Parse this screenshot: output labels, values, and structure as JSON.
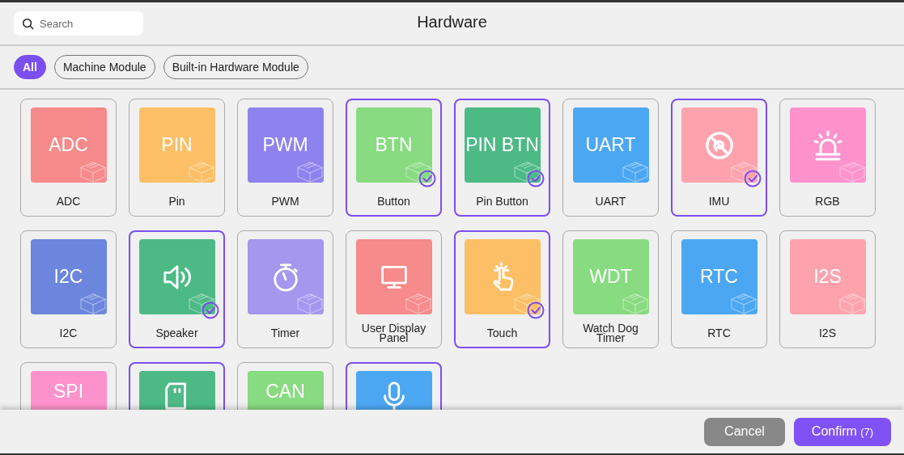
{
  "search": {
    "placeholder": "Search"
  },
  "title": "Hardware",
  "filters": [
    {
      "label": "All",
      "selected": true
    },
    {
      "label": "Machine Module",
      "selected": false
    },
    {
      "label": "Built-in Hardware Module",
      "selected": false
    }
  ],
  "modules": [
    {
      "label": "ADC",
      "kind": "text",
      "tile_text": "ADC",
      "color": "#f78a8a",
      "selected": false
    },
    {
      "label": "Pin",
      "kind": "text",
      "tile_text": "PIN",
      "color": "#fdbf66",
      "selected": false
    },
    {
      "label": "PWM",
      "kind": "text",
      "tile_text": "PWM",
      "color": "#8e82ee",
      "selected": false
    },
    {
      "label": "Button",
      "kind": "text",
      "tile_text": "BTN",
      "color": "#88db80",
      "selected": true
    },
    {
      "label": "Pin Button",
      "kind": "text",
      "tile_text": "PIN BTN",
      "color": "#4dba85",
      "selected": true
    },
    {
      "label": "UART",
      "kind": "text",
      "tile_text": "UART",
      "color": "#4ca7f2",
      "selected": false
    },
    {
      "label": "IMU",
      "kind": "imu",
      "color": "#fea3ae",
      "selected": true
    },
    {
      "label": "RGB",
      "kind": "rgb",
      "color": "#fe92cc",
      "selected": false
    },
    {
      "label": "I2C",
      "kind": "text",
      "tile_text": "I2C",
      "color": "#6b86dc",
      "selected": false
    },
    {
      "label": "Speaker",
      "kind": "speaker",
      "color": "#4dba85",
      "selected": true
    },
    {
      "label": "Timer",
      "kind": "timer",
      "color": "#a596ee",
      "selected": false
    },
    {
      "label": "User Display Panel",
      "kind": "display",
      "color": "#f78a8a",
      "selected": false
    },
    {
      "label": "Touch",
      "kind": "touch",
      "color": "#fdbf66",
      "selected": true
    },
    {
      "label": "Watch Dog Timer",
      "kind": "text",
      "tile_text": "WDT",
      "color": "#88db80",
      "selected": false
    },
    {
      "label": "RTC",
      "kind": "text",
      "tile_text": "RTC",
      "color": "#4ca7f2",
      "selected": false
    },
    {
      "label": "I2S",
      "kind": "text",
      "tile_text": "I2S",
      "color": "#fea3ae",
      "selected": false
    },
    {
      "kind": "text",
      "tile_text": "SPI",
      "color": "#fe92cc",
      "selected": false
    },
    {
      "kind": "sdcard",
      "color": "#4dba85",
      "selected": true
    },
    {
      "kind": "text",
      "tile_text": "CAN",
      "color": "#88db80",
      "selected": false
    },
    {
      "kind": "mic",
      "color": "#4ca7f2",
      "selected": true
    }
  ],
  "buttons": {
    "cancel": "Cancel",
    "confirm": "Confirm",
    "confirm_count": "(7)"
  }
}
